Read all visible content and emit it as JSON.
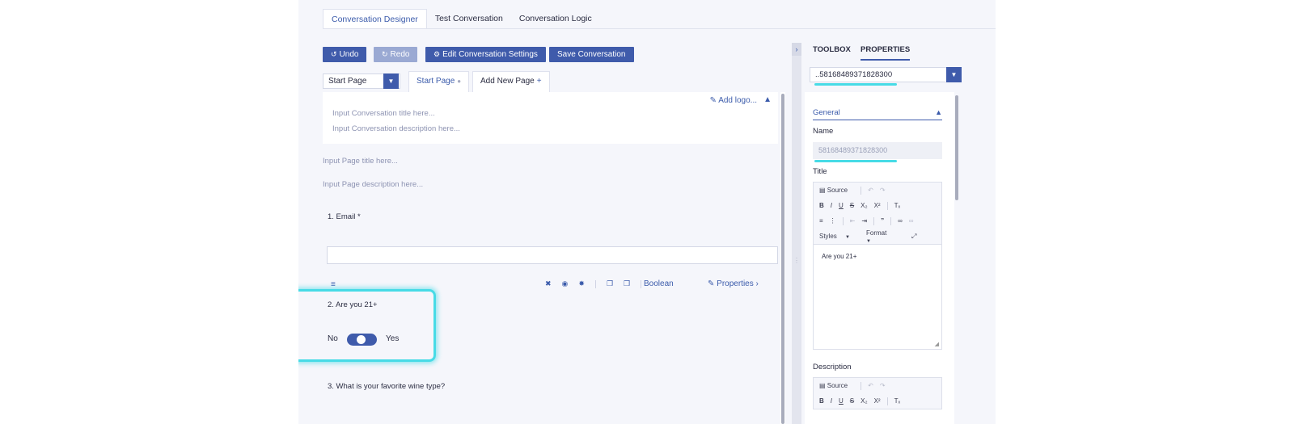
{
  "top_tabs": [
    {
      "label": "Conversation Designer",
      "active": true
    },
    {
      "label": "Test Conversation",
      "active": false
    },
    {
      "label": "Conversation Logic",
      "active": false
    }
  ],
  "toolbar": {
    "undo_label": "Undo",
    "redo_label": "Redo",
    "settings_label": "Edit Conversation Settings",
    "save_label": "Save Conversation"
  },
  "page_select": {
    "value": "Start Page"
  },
  "page_tabs": {
    "start": "Start Page",
    "add": "Add New Page",
    "plus": "+"
  },
  "conversation": {
    "add_logo": "Add logo...",
    "title_placeholder": "Input Conversation title here...",
    "description_placeholder": "Input Conversation description here..."
  },
  "page": {
    "title_placeholder": "Input Page title here...",
    "description_placeholder": "Input Page description here..."
  },
  "questions": {
    "q1": "1. Email *",
    "q2": "2. Are you 21+",
    "q2_no": "No",
    "q2_yes": "Yes",
    "q2_toggle_on": true,
    "q3": "3. What is your favorite wine type?",
    "type_label": "Boolean",
    "properties_label": "Properties"
  },
  "right_panel": {
    "tabs": [
      "TOOLBOX",
      "PROPERTIES"
    ],
    "active_tab": "PROPERTIES",
    "element_select": "..58168489371828300",
    "section": "General",
    "name_label": "Name",
    "name_value": "58168489371828300",
    "title_label": "Title",
    "description_label": "Description",
    "editor": {
      "source": "Source",
      "styles": "Styles",
      "format": "Format",
      "title_content": "Are you 21+"
    }
  },
  "colors": {
    "accent": "#3f5bab",
    "highlight": "#47dbe6",
    "background": "#f5f6fb"
  }
}
